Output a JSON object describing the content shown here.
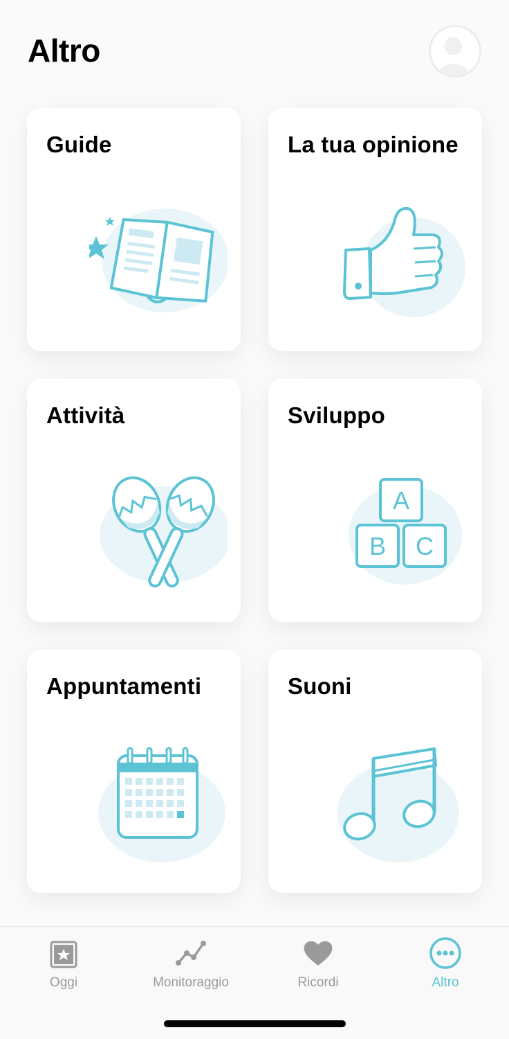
{
  "header": {
    "title": "Altro"
  },
  "colors": {
    "accent": "#5bc3d4",
    "blob": "#e9f5f9",
    "inactive": "#9a9a9a"
  },
  "cards": [
    {
      "title": "Guide",
      "icon": "book-icon"
    },
    {
      "title": "La tua opinione",
      "icon": "thumbs-up-icon"
    },
    {
      "title": "Attività",
      "icon": "maracas-icon"
    },
    {
      "title": "Sviluppo",
      "icon": "abc-blocks-icon"
    },
    {
      "title": "Appuntamenti",
      "icon": "calendar-icon"
    },
    {
      "title": "Suoni",
      "icon": "music-note-icon"
    }
  ],
  "blocks": {
    "a": "A",
    "b": "B",
    "c": "C"
  },
  "tabs": [
    {
      "label": "Oggi",
      "icon": "calendar-star-icon",
      "active": false
    },
    {
      "label": "Monitoraggio",
      "icon": "line-chart-icon",
      "active": false
    },
    {
      "label": "Ricordi",
      "icon": "heart-icon",
      "active": false
    },
    {
      "label": "Altro",
      "icon": "more-icon",
      "active": true
    }
  ]
}
